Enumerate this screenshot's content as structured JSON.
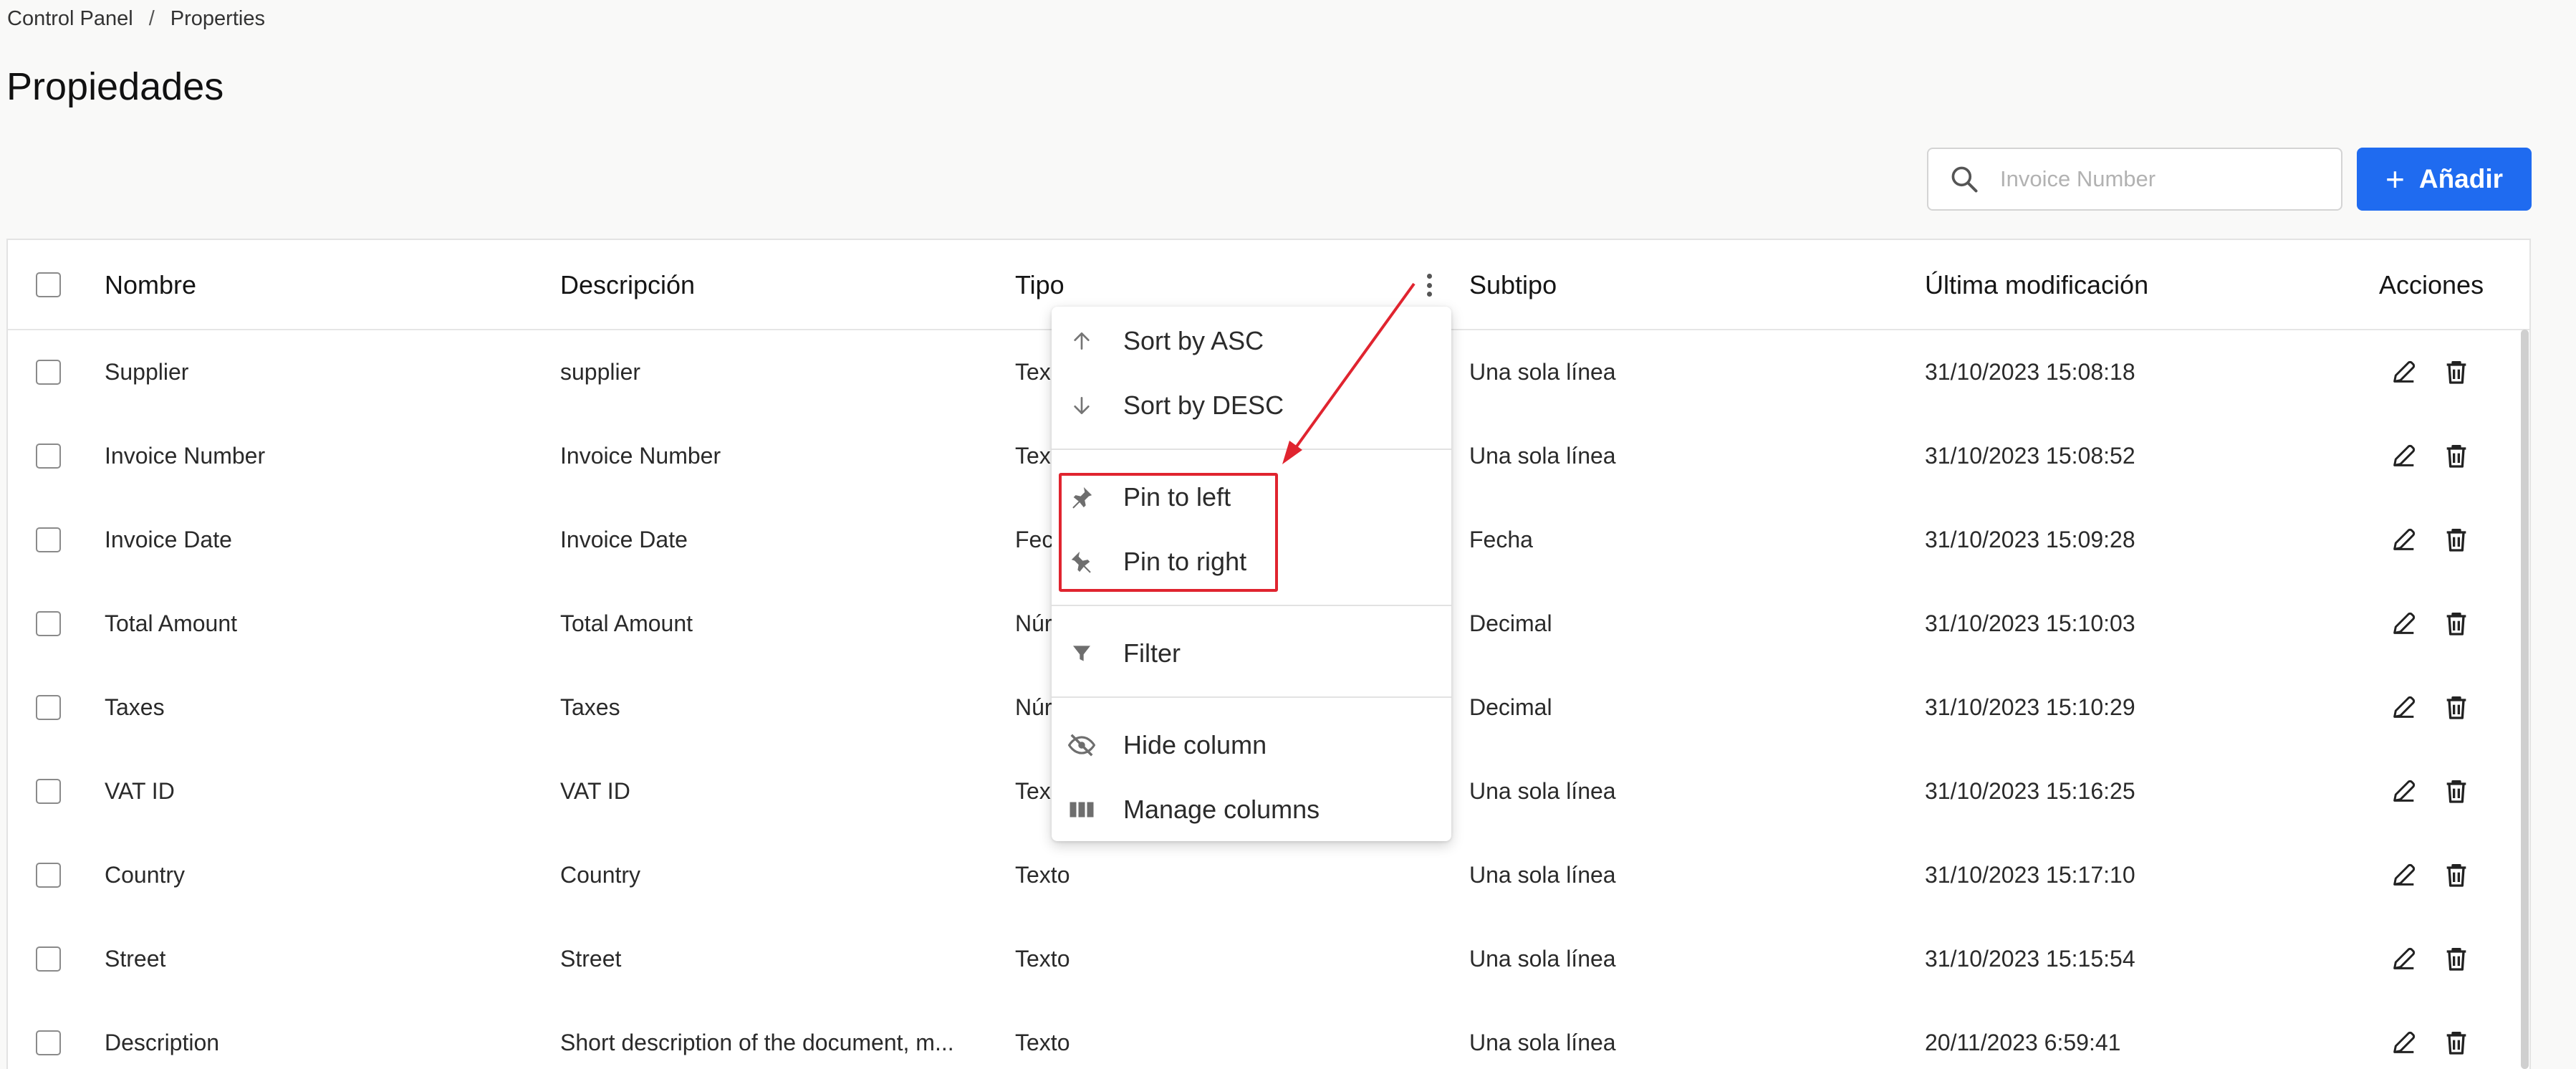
{
  "breadcrumb": {
    "root": "Control Panel",
    "separator": "/",
    "current": "Properties"
  },
  "page": {
    "title": "Propiedades"
  },
  "toolbar": {
    "search_placeholder": "Invoice Number",
    "add_label": "Añadir",
    "add_icon": "plus-icon",
    "search_icon": "search-icon"
  },
  "table": {
    "headers": {
      "name": "Nombre",
      "description": "Descripción",
      "type": "Tipo",
      "subtype": "Subtipo",
      "modified": "Última modificación",
      "actions": "Acciones"
    },
    "rows": [
      {
        "name": "Supplier",
        "description": "supplier",
        "type": "Tex",
        "subtype": "Una sola línea",
        "modified": "31/10/2023 15:08:18"
      },
      {
        "name": "Invoice Number",
        "description": "Invoice Number",
        "type": "Tex",
        "subtype": "Una sola línea",
        "modified": "31/10/2023 15:08:52"
      },
      {
        "name": "Invoice Date",
        "description": "Invoice Date",
        "type": "Fec",
        "subtype": "Fecha",
        "modified": "31/10/2023 15:09:28"
      },
      {
        "name": "Total Amount",
        "description": "Total Amount",
        "type": "Núr",
        "subtype": "Decimal",
        "modified": "31/10/2023 15:10:03"
      },
      {
        "name": "Taxes",
        "description": "Taxes",
        "type": "Núr",
        "subtype": "Decimal",
        "modified": "31/10/2023 15:10:29"
      },
      {
        "name": "VAT ID",
        "description": "VAT ID",
        "type": "Tex",
        "subtype": "Una sola línea",
        "modified": "31/10/2023 15:16:25"
      },
      {
        "name": "Country",
        "description": "Country",
        "type": "Texto",
        "subtype": "Una sola línea",
        "modified": "31/10/2023 15:17:10"
      },
      {
        "name": "Street",
        "description": "Street",
        "type": "Texto",
        "subtype": "Una sola línea",
        "modified": "31/10/2023 15:15:54"
      },
      {
        "name": "Description",
        "description": "Short description of the document, m...",
        "type": "Texto",
        "subtype": "Una sola línea",
        "modified": "20/11/2023 6:59:41"
      }
    ],
    "row_actions": [
      "edit-icon",
      "trash-icon"
    ]
  },
  "column_menu": {
    "items": [
      {
        "label": "Sort by ASC",
        "icon": "arrow-up-icon"
      },
      {
        "label": "Sort by DESC",
        "icon": "arrow-down-icon"
      },
      {
        "label": "Pin to left",
        "icon": "pin-left-icon"
      },
      {
        "label": "Pin to right",
        "icon": "pin-right-icon"
      },
      {
        "label": "Filter",
        "icon": "filter-icon"
      },
      {
        "label": "Hide column",
        "icon": "eye-off-icon"
      },
      {
        "label": "Manage columns",
        "icon": "columns-icon"
      }
    ]
  },
  "colors": {
    "primary": "#1f6bf0",
    "annotation": "#e0242f",
    "background": "#f9f9f8"
  }
}
